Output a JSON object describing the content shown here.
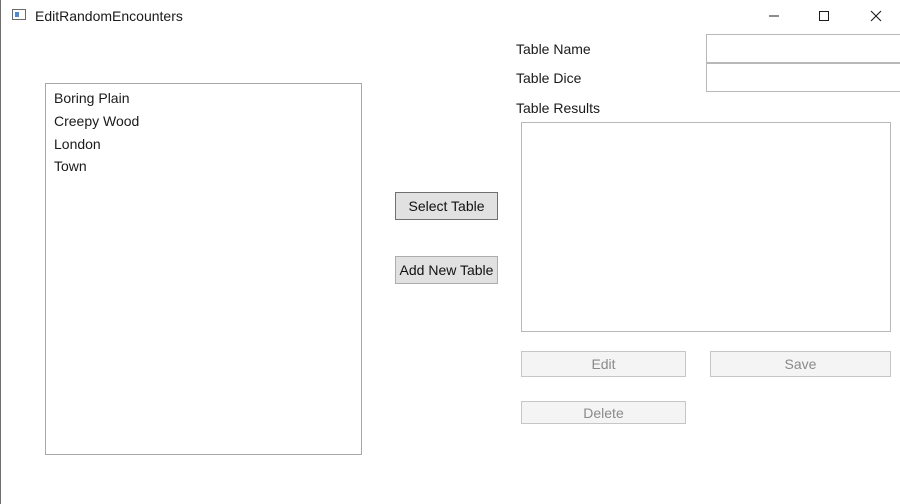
{
  "window": {
    "title": "EditRandomEncounters",
    "minimize_icon": "minimize-icon",
    "maximize_icon": "maximize-icon",
    "close_icon": "close-icon"
  },
  "tables_list": {
    "items": [
      "Boring Plain",
      "Creepy Wood",
      "London",
      "Town"
    ]
  },
  "actions": {
    "select_table": "Select Table",
    "add_new_table": "Add New Table"
  },
  "form": {
    "table_name_label": "Table Name",
    "table_name_value": "",
    "table_dice_label": "Table Dice",
    "table_dice_value": "",
    "table_results_label": "Table Results",
    "edit_label": "Edit",
    "save_label": "Save",
    "delete_label": "Delete"
  }
}
